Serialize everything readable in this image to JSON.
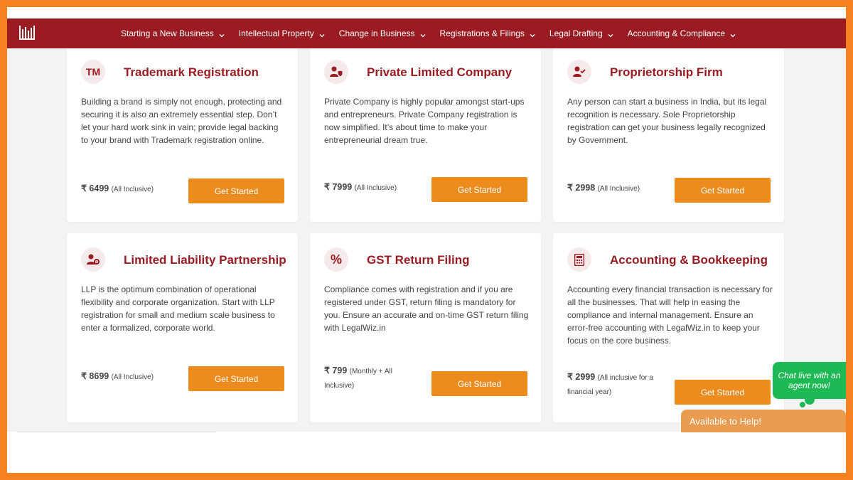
{
  "nav": {
    "logo_icon": "legalwiz-logo-icon",
    "items": [
      {
        "label": "Starting a New Business"
      },
      {
        "label": "Intellectual Property"
      },
      {
        "label": "Change in Business"
      },
      {
        "label": "Registrations & Filings"
      },
      {
        "label": "Legal Drafting"
      },
      {
        "label": "Accounting & Compliance"
      }
    ]
  },
  "cards": [
    {
      "icon": "trademark-icon",
      "icon_text": "TM",
      "title": "Trademark Registration",
      "description": "Building a brand is simply not enough, protecting and securing it is also an extremely essential step. Don’t let your hard work sink in vain; provide legal backing to your brand with Trademark registration online.",
      "price": "₹ 6499",
      "price_note": "(All Inclusive)",
      "button": "Get Started"
    },
    {
      "icon": "user-shield-icon",
      "title": "Private Limited Company",
      "description": "Private Company is highly popular amongst start-ups and entrepreneurs. Private Company registration is now simplified. It’s about time to make your entrepreneurial dream true.",
      "price": "₹ 7999",
      "price_note": "(All Inclusive)",
      "button": "Get Started"
    },
    {
      "icon": "user-check-icon",
      "title": "Proprietorship Firm",
      "description": "Any person can start a business in India, but its legal recognition is necessary. Sole Proprietorship registration can get your business legally recognized by Government.",
      "price": "₹ 2998",
      "price_note": "(All Inclusive)",
      "button": "Get Started"
    },
    {
      "icon": "user-cog-icon",
      "title": "Limited Liability Partnership",
      "description": "LLP is the optimum combination of operational flexibility and corporate organization. Start with LLP registration for small and medium scale business to enter a formalized, corporate world.",
      "price": "₹ 8699",
      "price_note": "(All Inclusive)",
      "button": "Get Started"
    },
    {
      "icon": "percent-icon",
      "icon_text": "%",
      "title": "GST Return Filing",
      "description": "Compliance comes with registration and if you are registered under GST, return filing is mandatory for you. Ensure an accurate and on-time GST return filing with LegalWiz.in",
      "price": "₹ 799",
      "price_note": "(Monthly + All Inclusive)",
      "button": "Get Started"
    },
    {
      "icon": "calculator-icon",
      "title": "Accounting & Bookkeeping",
      "description": "Accounting every financial transaction is necessary for all the businesses. That will help in easing the compliance and internal management. Ensure an error-free accounting with LegalWiz.in to keep your focus on the core business.",
      "price": "₹ 2999",
      "price_note": "(All inclusive for a financial year)",
      "button": "Get Started"
    }
  ],
  "chat": {
    "bubble_text": "Chat live with an agent now!",
    "available_text": "Available to Help!"
  },
  "colors": {
    "brand_red": "#9b1b22",
    "button_orange": "#ee8b1d",
    "frame_orange": "#f58220",
    "chat_green": "#1db954"
  }
}
